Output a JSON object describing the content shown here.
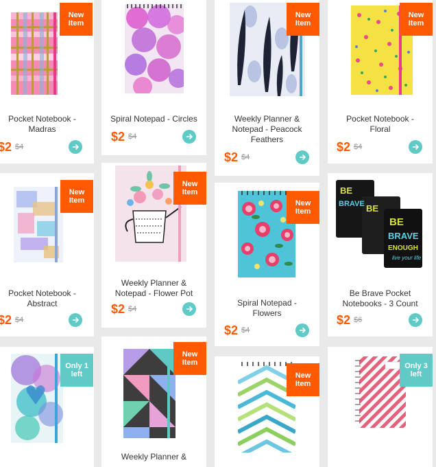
{
  "accent": "#ff5a00",
  "teal": "#5fcac6",
  "products": [
    {
      "title": "Pocket Notebook - Madras",
      "price": "$2",
      "was": "$4",
      "badge": "New Item",
      "badge_color": "#ff5a00",
      "icon": "arrow-right-icon"
    },
    {
      "title": "Spiral Notepad - Circles",
      "price": "$2",
      "was": "$4",
      "badge": "",
      "icon": "arrow-right-icon"
    },
    {
      "title": "Weekly Planner & Notepad - Peacock Feathers",
      "price": "$2",
      "was": "$4",
      "badge": "New Item",
      "badge_color": "#ff5a00",
      "icon": "arrow-right-icon"
    },
    {
      "title": "Pocket Notebook - Floral",
      "price": "$2",
      "was": "$4",
      "badge": "New Item",
      "badge_color": "#ff5a00",
      "icon": "arrow-right-icon"
    },
    {
      "title": "Pocket Notebook - Abstract",
      "price": "$2",
      "was": "$4",
      "badge": "New Item",
      "badge_color": "#ff5a00",
      "icon": "arrow-right-icon"
    },
    {
      "title": "Weekly Planner & Notepad - Flower Pot",
      "price": "$2",
      "was": "$4",
      "badge": "New Item",
      "badge_color": "#ff5a00",
      "icon": "arrow-right-icon"
    },
    {
      "title": "Spiral Notepad - Flowers",
      "price": "$2",
      "was": "$4",
      "badge": "New Item",
      "badge_color": "#ff5a00",
      "icon": "arrow-right-icon"
    },
    {
      "title": "Be Brave Pocket Notebooks - 3 Count",
      "price": "$2",
      "was": "$6",
      "badge": "",
      "icon": "arrow-right-icon",
      "art_text": "BE BRAVE ENOUGH live your life"
    },
    {
      "title": "",
      "price": "",
      "was": "",
      "badge": "Only 1 left",
      "badge_color": "#5fcac6"
    },
    {
      "title": "Weekly Planner &",
      "price": "",
      "was": "",
      "badge": "New Item",
      "badge_color": "#ff5a00"
    },
    {
      "title": "",
      "price": "",
      "was": "",
      "badge": "New Item",
      "badge_color": "#ff5a00"
    },
    {
      "title": "",
      "price": "",
      "was": "",
      "badge": "Only 3 left",
      "badge_color": "#5fcac6"
    }
  ]
}
